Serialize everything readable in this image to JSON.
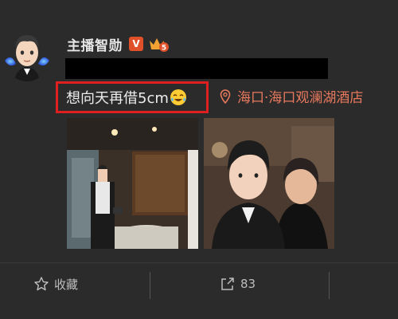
{
  "post": {
    "author": "主播智勋",
    "verified_badge": "V",
    "level_badge_icon": "member-crown-icon",
    "status_text": "想向天再借5cm",
    "status_emoji": "laughing-tears-emoji",
    "location": "海口·海口观澜湖酒店",
    "location_icon": "location-pin-icon"
  },
  "actions": {
    "favorite_label": "收藏",
    "repost_count": "83"
  },
  "colors": {
    "background": "#2b2b2b",
    "highlight_border": "#e02020",
    "location": "#e8795d",
    "verified": "#e0512a"
  }
}
